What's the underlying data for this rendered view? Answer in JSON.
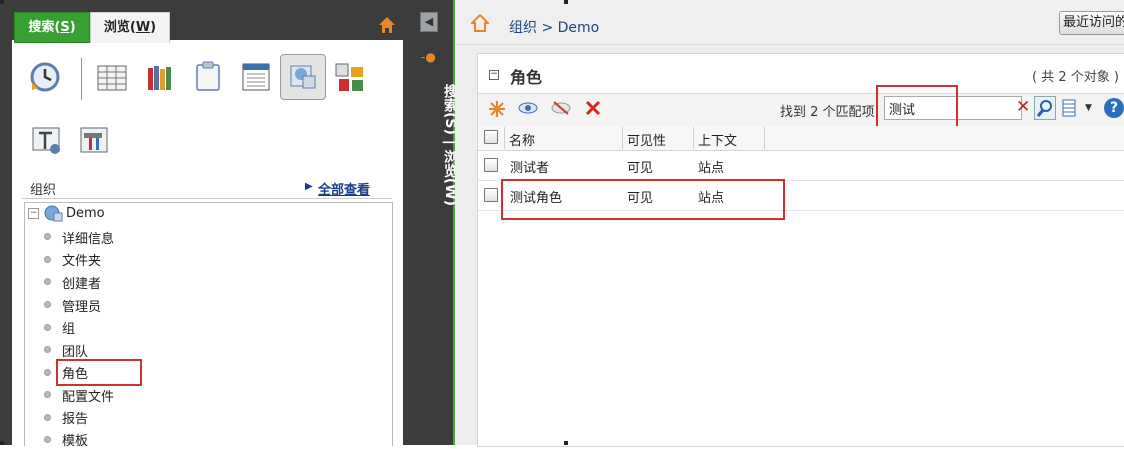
{
  "left_panel": {
    "tabs": [
      {
        "label": "搜索(",
        "key": "S",
        "suffix": ")"
      },
      {
        "label": "浏览(",
        "key": "W",
        "suffix": ")"
      }
    ],
    "org_label": "组织",
    "view_all": "全部查看",
    "tree": {
      "root": "Demo",
      "items": [
        "详细信息",
        "文件夹",
        "创建者",
        "管理员",
        "组",
        "团队",
        "角色",
        "配置文件",
        "报告",
        "模板"
      ]
    }
  },
  "middle_strip": {
    "vertical_label": "搜索(S) | 浏览(W)"
  },
  "right_panel": {
    "breadcrumb": "组织 > Demo",
    "recent_button": "最近访问的",
    "section_title": "角色",
    "count_text": "( 共 2 个对象 )",
    "match_text": "找到 2 个匹配项",
    "filter_value": "测试",
    "table": {
      "columns": [
        "名称",
        "可见性",
        "上下文"
      ],
      "rows": [
        {
          "name": "测试者",
          "visibility": "可见",
          "context": "站点"
        },
        {
          "name": "测试角色",
          "visibility": "可见",
          "context": "站点"
        }
      ]
    },
    "help": "?"
  },
  "colors": {
    "active_tab": "#36a131",
    "dark_chrome": "#3c3c3c",
    "link_blue": "#1c4480",
    "highlight_red": "#d03030"
  }
}
